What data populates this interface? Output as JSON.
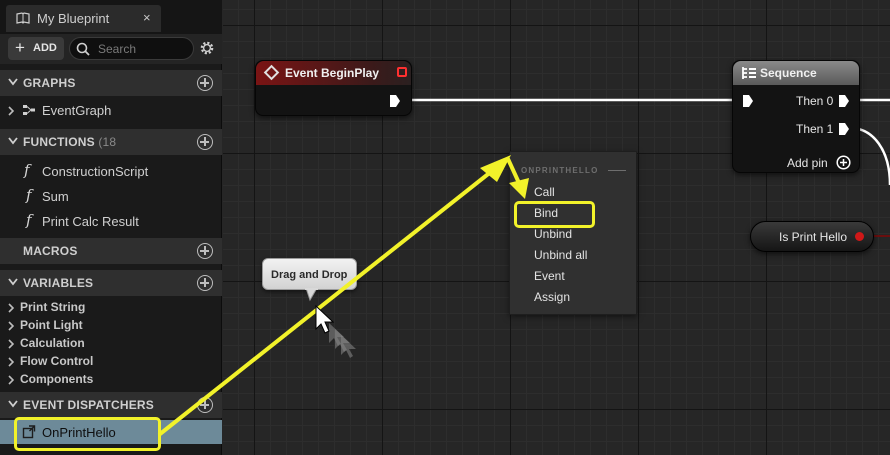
{
  "tab": {
    "title": "My Blueprint",
    "close": "×",
    "icon": "blueprint-book-icon"
  },
  "toolbar": {
    "add_label": "ADD",
    "search_placeholder": "Search"
  },
  "sections": {
    "graphs": {
      "title": "GRAPHS"
    },
    "functions": {
      "title": "FUNCTIONS",
      "count": "(18"
    },
    "macros": {
      "title": "MACROS"
    },
    "variables": {
      "title": "VARIABLES"
    },
    "dispatchers": {
      "title": "EVENT DISPATCHERS"
    }
  },
  "graphs_items": [
    "EventGraph"
  ],
  "function_items": [
    "ConstructionScript",
    "Sum",
    "Print Calc Result"
  ],
  "function_glyph": "f",
  "variable_categories": [
    "Print String",
    "Point Light",
    "Calculation",
    "Flow Control",
    "Components"
  ],
  "dispatcher_items": [
    "OnPrintHello"
  ],
  "nodes": {
    "begin_play": {
      "title": "Event BeginPlay"
    },
    "sequence": {
      "title": "Sequence",
      "pins": [
        "Then 0",
        "Then 1"
      ],
      "add_pin": "Add pin"
    },
    "is_print_hello": {
      "label": "Is Print Hello"
    }
  },
  "context_menu": {
    "header": "ONPRINTHELLO",
    "items": [
      "Call",
      "Bind",
      "Unbind",
      "Unbind all",
      "Event",
      "Assign"
    ],
    "highlighted": "Bind"
  },
  "tooltip": {
    "label": "Drag and Drop"
  },
  "colors": {
    "highlight": "#f2f22a",
    "selection": "#6d8a99",
    "event_header": "#7a1414",
    "bool_pin": "#d01818"
  }
}
